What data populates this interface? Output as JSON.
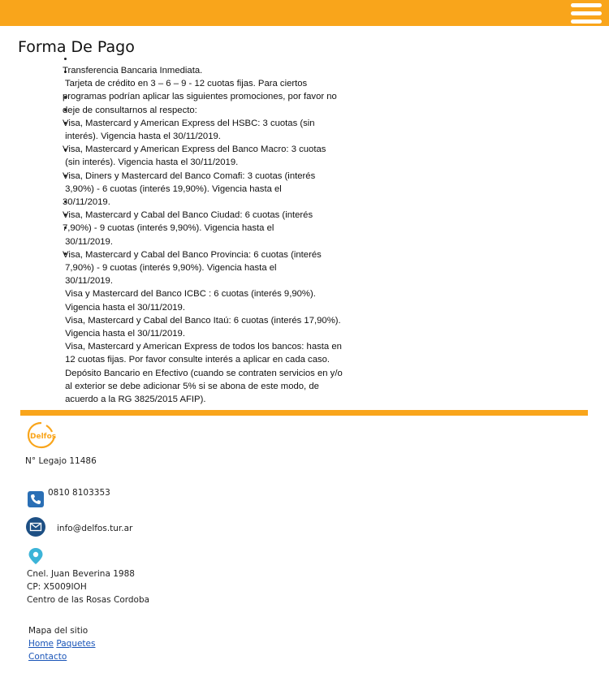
{
  "header": {
    "menu_icon": "hamburger-menu-icon"
  },
  "page": {
    "title": "Forma De Pago"
  },
  "content": {
    "lines": [
      "Transferencia Bancaria Inmediata.",
      " Tarjeta de crédito en 3 – 6 – 9 - 12 cuotas fijas. Para ciertos",
      "programas podrían aplicar las siguientes promociones, por favor no",
      "deje de consultarnos al respecto:",
      "Visa, Mastercard y American Express del HSBC: 3 cuotas (sin",
      " interés). Vigencia hasta el 30/11/2019.",
      "Visa, Mastercard y American Express del Banco Macro: 3 cuotas",
      " (sin interés). Vigencia hasta el 30/11/2019.",
      "Visa, Diners y Mastercard del Banco Comafi: 3 cuotas (interés",
      " 3,90%) - 6 cuotas (interés 19,90%). Vigencia hasta el",
      "30/11/2019.",
      "Visa, Mastercard y Cabal del Banco Ciudad: 6 cuotas (interés",
      "7,90%) - 9 cuotas (interés 9,90%). Vigencia hasta el",
      " 30/11/2019.",
      "Visa, Mastercard y Cabal del Banco Provincia: 6 cuotas (interés",
      " 7,90%) - 9 cuotas (interés 9,90%). Vigencia hasta el",
      " 30/11/2019.",
      " Visa y Mastercard del Banco ICBC : 6 cuotas (interés 9,90%).",
      " Vigencia hasta el 30/11/2019.",
      " Visa, Mastercard y Cabal del Banco Itaú: 6 cuotas (interés 17,90%).",
      " Vigencia hasta el 30/11/2019.",
      " Visa, Mastercard y American Express de todos los bancos: hasta en",
      " 12 cuotas fijas. Por favor consulte interés a aplicar en cada caso.",
      " Depósito Bancario en Efectivo (cuando se contraten servicios en y/o",
      " al exterior se debe adicionar 5% si se abona de este modo, de",
      " acuerdo a la RG 3825/2015 AFIP)."
    ]
  },
  "footer": {
    "logo_text": "Delfos",
    "legajo": "N° Legajo 11486",
    "phone": "0810 8103353",
    "email": "info@delfos.tur.ar",
    "address": [
      "Cnel. Juan Beverina 1988",
      "CP: X5009IOH",
      "Centro de las Rosas Cordoba"
    ],
    "sitemap_title": "Mapa del sitio",
    "links": {
      "home": "Home",
      "paquetes": "Paquetes",
      "contacto": "Contacto"
    }
  },
  "colors": {
    "accent": "#f9a51b",
    "link": "#1a55b8",
    "icon_blue": "#2a6fb5",
    "pin": "#3cb4d8"
  }
}
